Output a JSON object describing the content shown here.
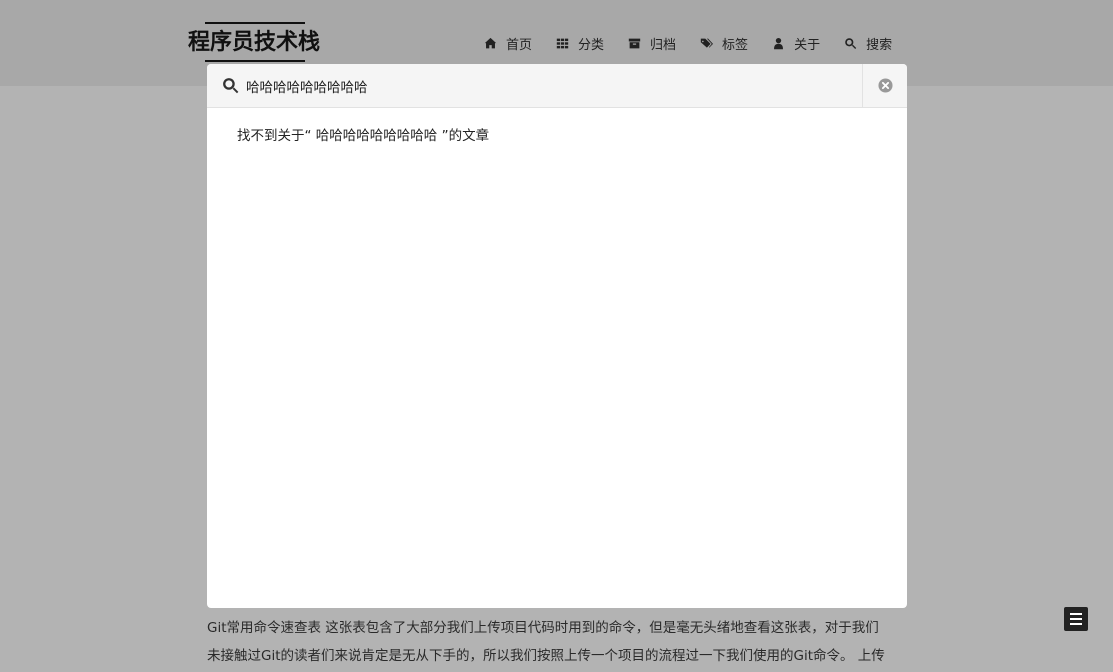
{
  "header": {
    "logo": "程序员技术栈",
    "nav": [
      {
        "icon": "home-icon",
        "label": "首页"
      },
      {
        "icon": "th-icon",
        "label": "分类"
      },
      {
        "icon": "archive-icon",
        "label": "归档"
      },
      {
        "icon": "tags-icon",
        "label": "标签"
      },
      {
        "icon": "user-icon",
        "label": "关于"
      },
      {
        "icon": "search-icon",
        "label": "搜索"
      }
    ]
  },
  "search": {
    "value": "哈哈哈哈哈哈哈哈哈",
    "no_result": "找不到关于“ 哈哈哈哈哈哈哈哈哈 ”的文章"
  },
  "article": {
    "line1": "Git常用命令速查表 这张表包含了大部分我们上传项目代码时用到的命令，但是毫无头绪地查看这张表，对于我们",
    "line2": "未接触过Git的读者们来说肯定是无从下手的，所以我们按照上传一个项目的流程过一下我们使用的Git命令。 上传"
  },
  "colors": {
    "overlay_bg": "#b3b3b3",
    "modal_bg": "#ffffff",
    "search_bar_bg": "#f5f5f5",
    "menu_button_bg": "#222222"
  }
}
